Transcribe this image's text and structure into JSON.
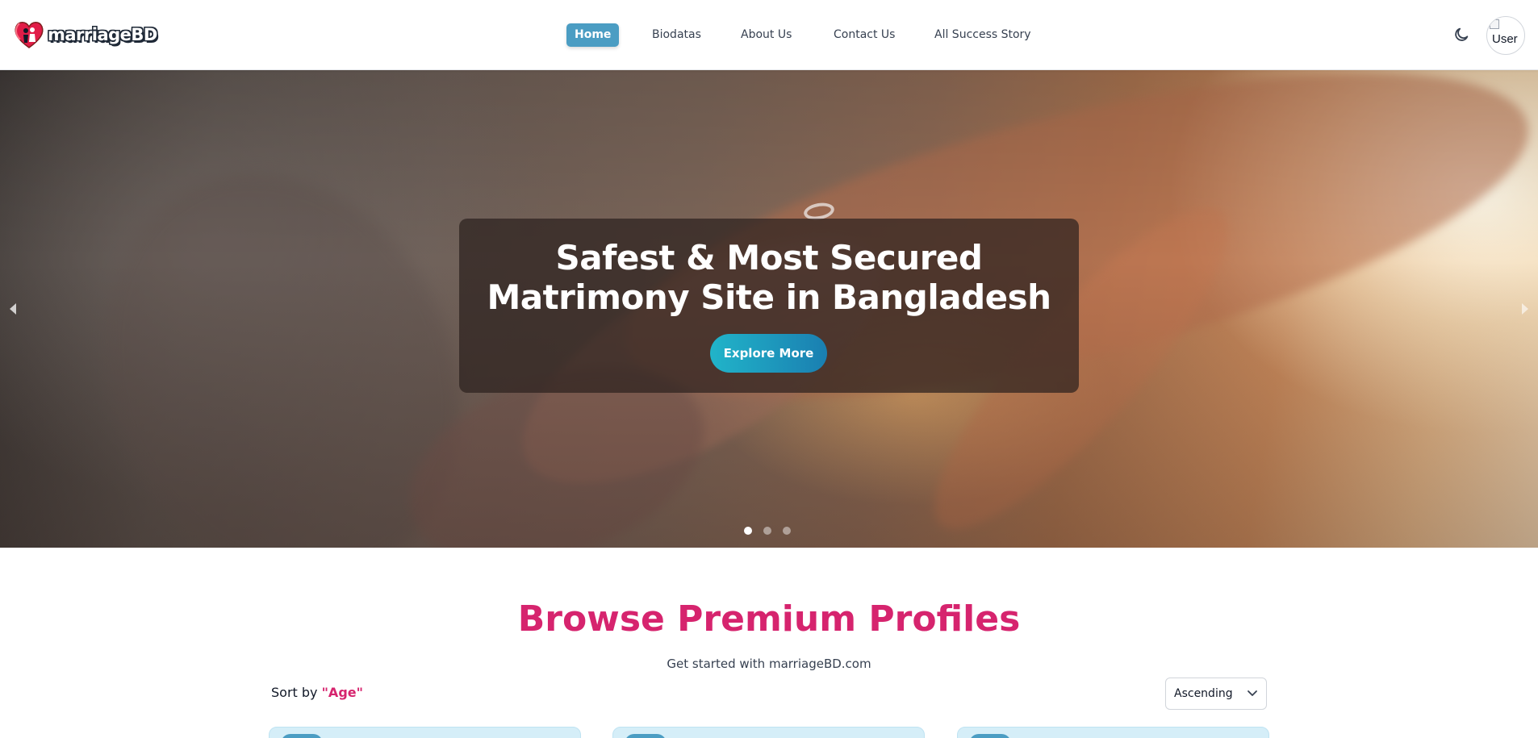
{
  "brand": {
    "name": "marriageBD"
  },
  "nav": {
    "items": [
      {
        "label": "Home",
        "active": true
      },
      {
        "label": "Biodatas",
        "active": false
      },
      {
        "label": "About Us",
        "active": false
      },
      {
        "label": "Contact Us",
        "active": false
      },
      {
        "label": "All Success Story",
        "active": false
      }
    ],
    "theme_icon": "moon-icon",
    "avatar_alt": "User"
  },
  "hero": {
    "title_line1": "Safest & Most Secured",
    "title_line2": "Matrimony Site in Bangladesh",
    "cta_label": "Explore More",
    "slide_count": 3,
    "active_slide": 1
  },
  "section": {
    "title": "Browse Premium Profiles",
    "subtitle": "Get started with marriageBD.com",
    "sort_prefix": "Sort by ",
    "sort_key": "\"Age\"",
    "sort_order": "Ascending"
  },
  "colors": {
    "accent": "#4b9dc3",
    "title_pink": "#d6246e",
    "card_bg": "#d5eef8"
  }
}
